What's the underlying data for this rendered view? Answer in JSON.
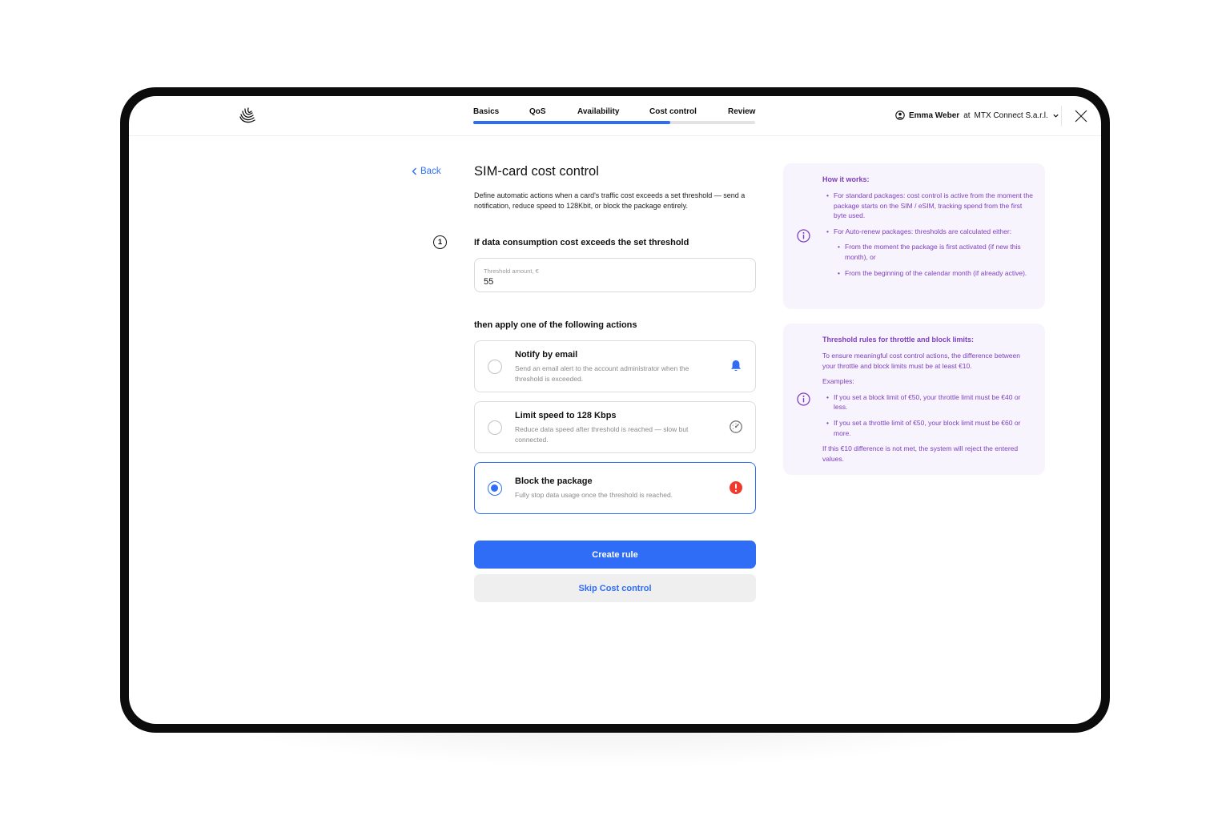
{
  "header": {
    "steps": [
      {
        "label": "Basics"
      },
      {
        "label": "QoS"
      },
      {
        "label": "Availability"
      },
      {
        "label": "Cost control"
      },
      {
        "label": "Review"
      }
    ],
    "progress": 0.7,
    "user_name": "Emma Weber",
    "user_connector": "at",
    "user_org": "MTX Connect S.a.r.l."
  },
  "nav": {
    "back_label": "Back"
  },
  "page": {
    "title": "SIM-card cost control",
    "description": "Define automatic actions when a card's traffic cost exceeds a set threshold — send a notification, reduce speed to 128Kbit, or block the package entirely."
  },
  "threshold": {
    "step_number": "1",
    "heading": "If data consumption cost exceeds the set threshold",
    "field_label": "Threshold amount, €",
    "value": "55"
  },
  "actions": {
    "heading": "then apply one of the following actions",
    "options": [
      {
        "title": "Notify by email",
        "description": "Send an email alert to the account administrator when the threshold is exceeded.",
        "icon": "bell-icon",
        "selected": false
      },
      {
        "title": "Limit speed to 128 Kbps",
        "description": "Reduce data speed after threshold is reached — slow but connected.",
        "icon": "speedometer-icon",
        "selected": false
      },
      {
        "title": "Block the package",
        "description": "Fully stop data usage once the threshold is reached.",
        "icon": "alert-icon",
        "selected": true
      }
    ]
  },
  "buttons": {
    "create": "Create rule",
    "skip": "Skip Cost control"
  },
  "info_how": {
    "title": "How it works:",
    "bullet1": "For standard packages: cost control is active from the moment the package starts on the SIM / eSIM, tracking spend from the first byte used.",
    "bullet2": "For Auto-renew packages: thresholds are calculated either:",
    "sub1": "From the moment the package is first activated (if new this month), or",
    "sub2": "From the beginning of the calendar month (if already active)."
  },
  "info_rules": {
    "title": "Threshold rules for throttle and block limits:",
    "intro": "To ensure meaningful cost control actions, the difference between your throttle and block limits must be at least €10.",
    "examples_label": "Examples:",
    "example1": "If you set a block limit of €50, your throttle limit must be €40 or less.",
    "example2": "If you set a throttle limit of €50, your block limit must be €60 or more.",
    "outro": "If this €10 difference is not met, the system will reject the entered values."
  },
  "colors": {
    "accent": "#2f6df6",
    "info_text": "#7e3fc0",
    "info_bg": "#f8f4fd",
    "danger": "#f03a2e"
  }
}
